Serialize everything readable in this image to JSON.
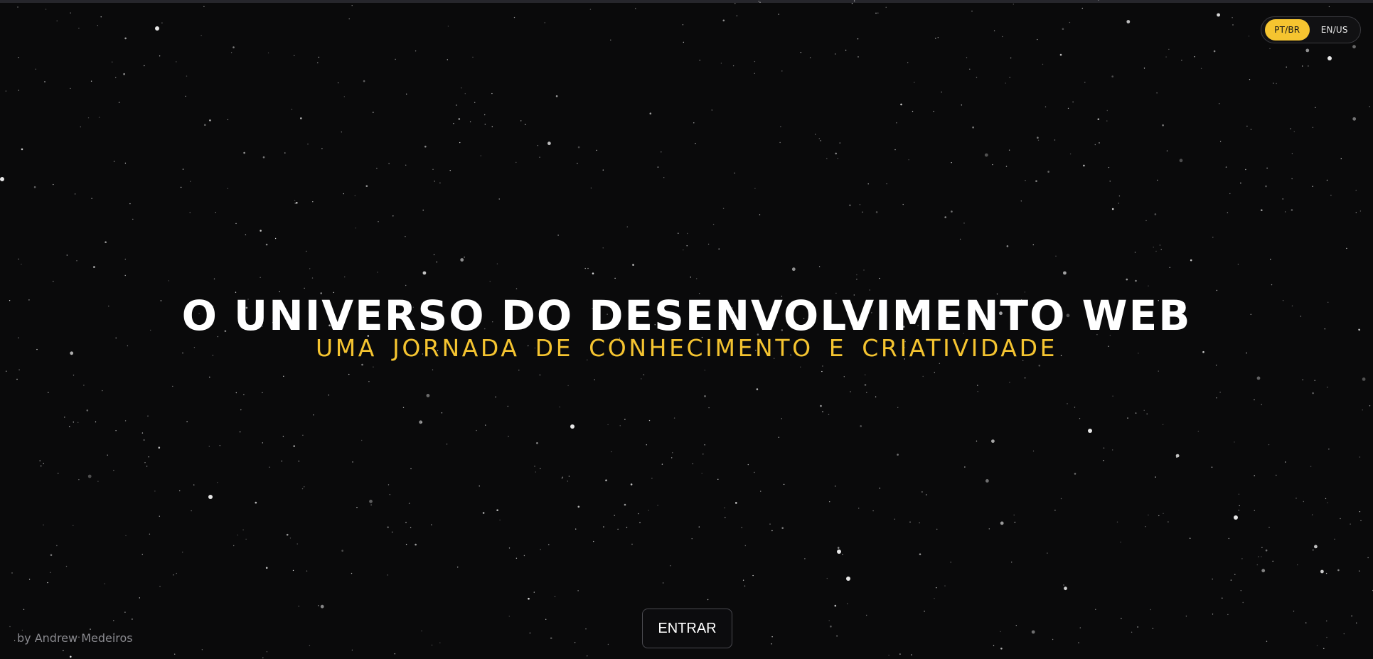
{
  "language_toggle": {
    "options": [
      "PT/BR",
      "EN/US"
    ],
    "selected": "PT/BR",
    "active_color": "#f5c430"
  },
  "hero": {
    "title": "O UNIVERSO DO DESENVOLVIMENTO WEB",
    "subtitle": "UMA JORNADA DE CONHECIMENTO E CRIATIVIDADE"
  },
  "enter_button": {
    "label": "ENTRAR"
  },
  "footer": {
    "author": "by Andrew Medeiros"
  },
  "theme": {
    "background": "#0a0a0b",
    "accent": "#f5c430",
    "text": "#ffffff"
  }
}
